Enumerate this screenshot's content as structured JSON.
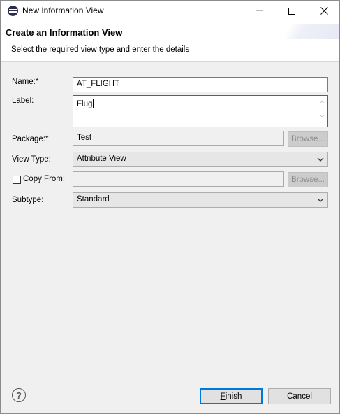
{
  "window": {
    "title": "New Information View"
  },
  "banner": {
    "title": "Create an Information View",
    "subtitle": "Select the required view type and enter the details"
  },
  "form": {
    "name": {
      "label": "Name:*",
      "value": "AT_FLIGHT"
    },
    "label_field": {
      "label": "Label:",
      "value": "Flug"
    },
    "package": {
      "label": "Package:*",
      "value": "Test",
      "browse_label": "Browse..."
    },
    "view_type": {
      "label": "View Type:",
      "value": "Attribute View"
    },
    "copy_from": {
      "label": "Copy From:",
      "value": "",
      "checked": false,
      "browse_label": "Browse..."
    },
    "subtype": {
      "label": "Subtype:",
      "value": "Standard"
    }
  },
  "footer": {
    "help_icon": "help-icon",
    "finish_first": "F",
    "finish_rest": "inish",
    "cancel_label": "Cancel"
  }
}
